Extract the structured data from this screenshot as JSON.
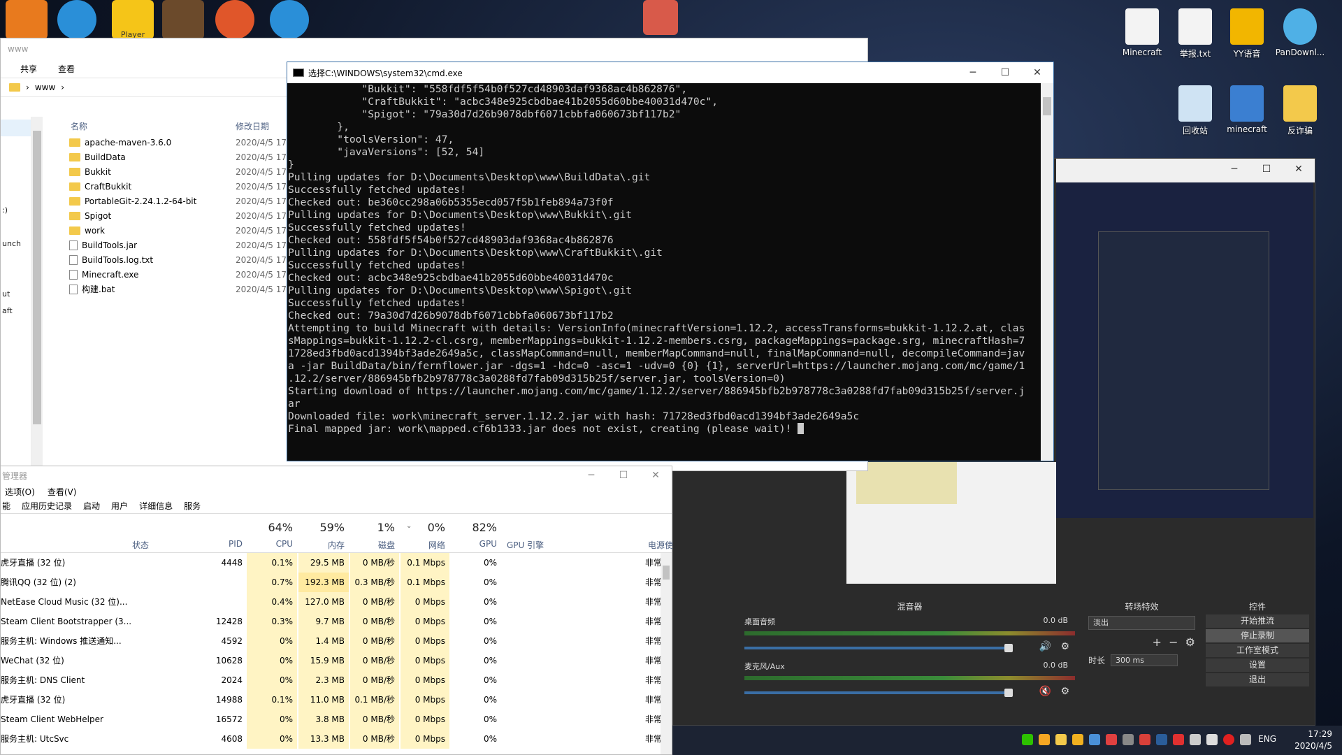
{
  "desktop": {
    "icons": [
      {
        "label": "Minecraft"
      },
      {
        "label": "举报.txt"
      },
      {
        "label": "YY语音"
      },
      {
        "label": "PanDownl..."
      },
      {
        "label": "回收站"
      },
      {
        "label": "minecraft"
      },
      {
        "label": "反诈骗"
      }
    ],
    "top_icon_labels": [
      "Player"
    ]
  },
  "explorer": {
    "title": "www",
    "ribbon": [
      "共享",
      "查看"
    ],
    "breadcrumb": [
      "www"
    ],
    "nav": [
      "",
      ":)",
      "unch",
      "ut",
      "aft"
    ],
    "columns": {
      "name": "名称",
      "date": "修改日期"
    },
    "files": [
      {
        "name": "apache-maven-3.6.0",
        "date": "2020/4/5 17",
        "type": "folder"
      },
      {
        "name": "BuildData",
        "date": "2020/4/5 17",
        "type": "folder"
      },
      {
        "name": "Bukkit",
        "date": "2020/4/5 17",
        "type": "folder"
      },
      {
        "name": "CraftBukkit",
        "date": "2020/4/5 17",
        "type": "folder"
      },
      {
        "name": "PortableGit-2.24.1.2-64-bit",
        "date": "2020/4/5 17",
        "type": "folder"
      },
      {
        "name": "Spigot",
        "date": "2020/4/5 17",
        "type": "folder"
      },
      {
        "name": "work",
        "date": "2020/4/5 17",
        "type": "folder"
      },
      {
        "name": "BuildTools.jar",
        "date": "2020/4/5 17",
        "type": "file"
      },
      {
        "name": "BuildTools.log.txt",
        "date": "2020/4/5 17",
        "type": "file"
      },
      {
        "name": "Minecraft.exe",
        "date": "2020/4/5 17",
        "type": "file"
      },
      {
        "name": "构建.bat",
        "date": "2020/4/5 17",
        "type": "file"
      }
    ]
  },
  "cmd": {
    "title": "选择C:\\WINDOWS\\system32\\cmd.exe",
    "lines": [
      "            \"Bukkit\": \"558fdf5f54b0f527cd48903daf9368ac4b862876\",",
      "            \"CraftBukkit\": \"acbc348e925cbdbae41b2055d60bbe40031d470c\",",
      "            \"Spigot\": \"79a30d7d26b9078dbf6071cbbfa060673bf117b2\"",
      "        },",
      "        \"toolsVersion\": 47,",
      "        \"javaVersions\": [52, 54]",
      "}",
      "",
      "Pulling updates for D:\\Documents\\Desktop\\www\\BuildData\\.git",
      "Successfully fetched updates!",
      "Checked out: be360cc298a06b5355ecd057f5b1feb894a73f0f",
      "Pulling updates for D:\\Documents\\Desktop\\www\\Bukkit\\.git",
      "Successfully fetched updates!",
      "Checked out: 558fdf5f54b0f527cd48903daf9368ac4b862876",
      "Pulling updates for D:\\Documents\\Desktop\\www\\CraftBukkit\\.git",
      "Successfully fetched updates!",
      "Checked out: acbc348e925cbdbae41b2055d60bbe40031d470c",
      "Pulling updates for D:\\Documents\\Desktop\\www\\Spigot\\.git",
      "Successfully fetched updates!",
      "Checked out: 79a30d7d26b9078dbf6071cbbfa060673bf117b2",
      "Attempting to build Minecraft with details: VersionInfo(minecraftVersion=1.12.2, accessTransforms=bukkit-1.12.2.at, clas",
      "sMappings=bukkit-1.12.2-cl.csrg, memberMappings=bukkit-1.12.2-members.csrg, packageMappings=package.srg, minecraftHash=7",
      "1728ed3fbd0acd1394bf3ade2649a5c, classMapCommand=null, memberMapCommand=null, finalMapCommand=null, decompileCommand=jav",
      "a -jar BuildData/bin/fernflower.jar -dgs=1 -hdc=0 -asc=1 -udv=0 {0} {1}, serverUrl=https://launcher.mojang.com/mc/game/1",
      ".12.2/server/886945bfb2b978778c3a0288fd7fab09d315b25f/server.jar, toolsVersion=0)",
      "Starting download of https://launcher.mojang.com/mc/game/1.12.2/server/886945bfb2b978778c3a0288fd7fab09d315b25f/server.j",
      "ar",
      "Downloaded file: work\\minecraft_server.1.12.2.jar with hash: 71728ed3fbd0acd1394bf3ade2649a5c",
      "Final mapped jar: work\\mapped.cf6b1333.jar does not exist, creating (please wait)! "
    ]
  },
  "obs": {
    "mixer_title": "混音器",
    "tracks": [
      {
        "name": "桌面音频",
        "db": "0.0 dB"
      },
      {
        "name": "麦克风/Aux",
        "db": "0.0 dB"
      }
    ],
    "transitions_title": "转场特效",
    "transition_value": "淡出",
    "duration_label": "时长",
    "duration_value": "300 ms",
    "controls_title": "控件",
    "controls": [
      "开始推流",
      "停止录制",
      "工作室模式",
      "设置",
      "退出"
    ]
  },
  "taskmgr": {
    "title": "管理器",
    "menu": [
      "选项(O)",
      "查看(V)"
    ],
    "tabs": [
      "能",
      "应用历史记录",
      "启动",
      "用户",
      "详细信息",
      "服务"
    ],
    "headers": {
      "status": "状态",
      "pid": "PID",
      "cpu_pct": "64%",
      "cpu": "CPU",
      "mem_pct": "59%",
      "mem": "内存",
      "disk_pct": "1%",
      "disk": "磁盘",
      "net_pct": "0%",
      "net": "网络",
      "gpu_pct": "82%",
      "gpu": "GPU",
      "gpu_engine": "GPU 引擎",
      "power": "电源使"
    },
    "rows": [
      {
        "name": "虎牙直播 (32 位)",
        "pid": "4448",
        "cpu": "0.1%",
        "mem": "29.5 MB",
        "disk": "0 MB/秒",
        "net": "0.1 Mbps",
        "gpu": "0%",
        "pwr": "非常"
      },
      {
        "name": "腾讯QQ (32 位) (2)",
        "pid": "",
        "cpu": "0.7%",
        "mem": "192.3 MB",
        "disk": "0.3 MB/秒",
        "net": "0.1 Mbps",
        "gpu": "0%",
        "pwr": "非常"
      },
      {
        "name": "NetEase Cloud Music (32 位)...",
        "pid": "",
        "cpu": "0.4%",
        "mem": "127.0 MB",
        "disk": "0 MB/秒",
        "net": "0 Mbps",
        "gpu": "0%",
        "pwr": "非常"
      },
      {
        "name": "Steam Client Bootstrapper (3...",
        "pid": "12428",
        "cpu": "0.3%",
        "mem": "9.7 MB",
        "disk": "0 MB/秒",
        "net": "0 Mbps",
        "gpu": "0%",
        "pwr": "非常"
      },
      {
        "name": "服务主机: Windows 推送通知...",
        "pid": "4592",
        "cpu": "0%",
        "mem": "1.4 MB",
        "disk": "0 MB/秒",
        "net": "0 Mbps",
        "gpu": "0%",
        "pwr": "非常"
      },
      {
        "name": "WeChat (32 位)",
        "pid": "10628",
        "cpu": "0%",
        "mem": "15.9 MB",
        "disk": "0 MB/秒",
        "net": "0 Mbps",
        "gpu": "0%",
        "pwr": "非常"
      },
      {
        "name": "服务主机: DNS Client",
        "pid": "2024",
        "cpu": "0%",
        "mem": "2.3 MB",
        "disk": "0 MB/秒",
        "net": "0 Mbps",
        "gpu": "0%",
        "pwr": "非常"
      },
      {
        "name": "虎牙直播 (32 位)",
        "pid": "14988",
        "cpu": "0.1%",
        "mem": "11.0 MB",
        "disk": "0.1 MB/秒",
        "net": "0 Mbps",
        "gpu": "0%",
        "pwr": "非常"
      },
      {
        "name": "Steam Client WebHelper",
        "pid": "16572",
        "cpu": "0%",
        "mem": "3.8 MB",
        "disk": "0 MB/秒",
        "net": "0 Mbps",
        "gpu": "0%",
        "pwr": "非常"
      },
      {
        "name": "服务主机: UtcSvc",
        "pid": "4608",
        "cpu": "0%",
        "mem": "13.3 MB",
        "disk": "0 MB/秒",
        "net": "0 Mbps",
        "gpu": "0%",
        "pwr": "非常"
      }
    ]
  },
  "taskbar": {
    "lang": "ENG",
    "time": "17:29",
    "date": "2020/4/5"
  }
}
